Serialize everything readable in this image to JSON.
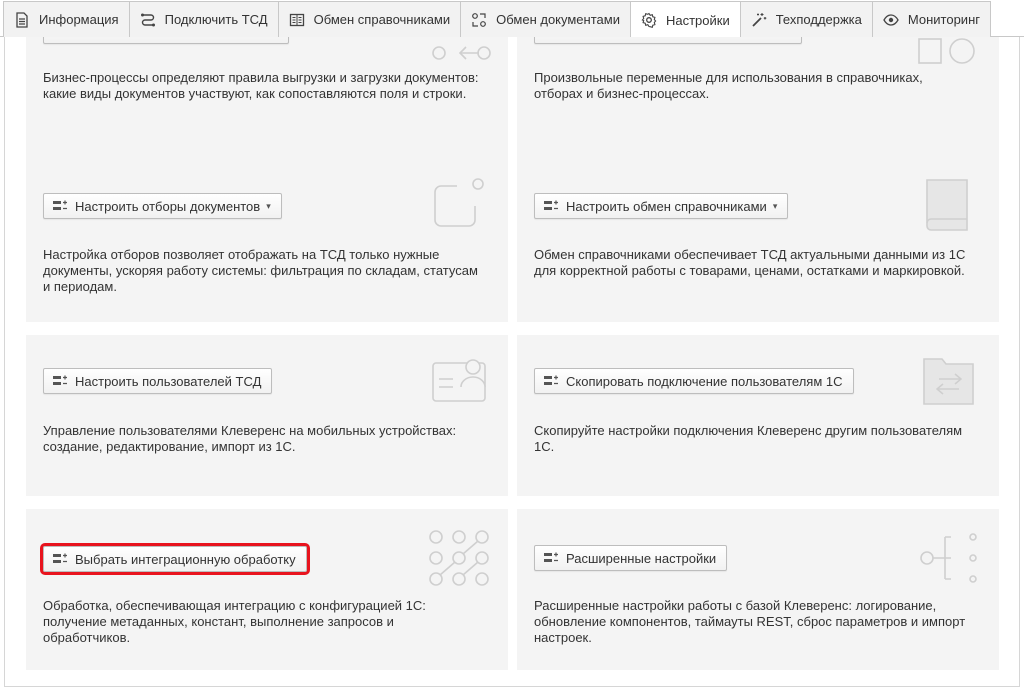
{
  "tabs": [
    {
      "label": "Информация",
      "icon": "document-icon"
    },
    {
      "label": "Подключить ТСД",
      "icon": "route-icon"
    },
    {
      "label": "Обмен справочниками",
      "icon": "book-icon"
    },
    {
      "label": "Обмен документами",
      "icon": "exchange-icon"
    },
    {
      "label": "Настройки",
      "icon": "gear-icon",
      "active": true
    },
    {
      "label": "Техподдержка",
      "icon": "magic-wand-icon"
    },
    {
      "label": "Мониторинг",
      "icon": "eye-icon"
    }
  ],
  "cards": {
    "business_processes": {
      "desc": "Бизнес-процессы определяют правила выгрузки и загрузки документов: какие виды документов участвуют, как сопоставляются поля и строки."
    },
    "variables": {
      "desc": "Произвольные переменные для использования в справочниках, отборах и бизнес-процессах."
    },
    "filters": {
      "button": "Настроить отборы документов",
      "desc": "Настройка отборов позволяет отображать на ТСД только нужные документы, ускоряя работу системы: фильтрация по складам, статусам и периодам."
    },
    "catalog_exchange": {
      "button": "Настроить обмен справочниками",
      "desc": "Обмен справочниками обеспечивает ТСД актуальными данными из 1С для корректной работы с товарами, ценами, остатками и маркировкой."
    },
    "users": {
      "button": "Настроить пользователей ТСД",
      "desc": "Управление пользователями Клеверенс на мобильных устройствах: создание, редактирование, импорт из 1С."
    },
    "copy_connection": {
      "button": "Скопировать подключение пользователям 1С",
      "desc": "Скопируйте настройки подключения Клеверенс другим пользователям 1С."
    },
    "integration": {
      "button": "Выбрать интеграционную обработку",
      "desc": "Обработка, обеспечивающая интеграцию с конфигурацией 1С: получение метаданных, констант, выполнение запросов и обработчиков."
    },
    "advanced": {
      "button": "Расширенные настройки",
      "desc": "Расширенные настройки работы с базой Клеверенс: логирование, обновление компонентов, таймауты REST, сброс параметров и импорт настроек."
    }
  },
  "colors": {
    "highlight": "#e8141e",
    "card_bg": "#f4f4f4",
    "deco": "#cfcfcf"
  }
}
